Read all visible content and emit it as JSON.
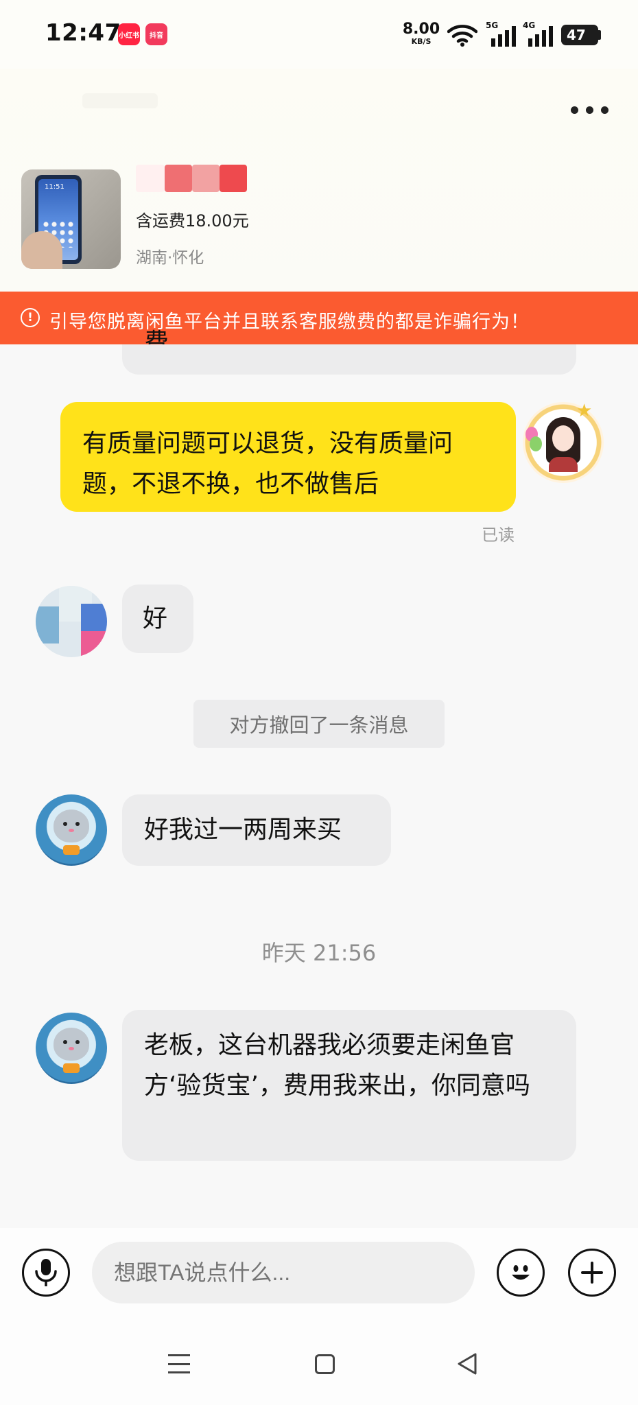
{
  "status_bar": {
    "time": "12:47",
    "app_icons": [
      "小红书",
      "抖音"
    ],
    "net_speed_value": "8.00",
    "net_speed_unit": "KB/S",
    "signal_1_label": "5G",
    "signal_2_label": "4G",
    "battery": "47"
  },
  "product": {
    "price_text": "含运费18.00元",
    "location": "湖南·怀化",
    "image_time": "11:51"
  },
  "warning": {
    "icon": "exclamation-icon",
    "text": "引导您脱离闲鱼平台并且联系客服缴费的都是诈骗行为！"
  },
  "messages": {
    "top_partial_text": "费吗",
    "reply_quality": "有质量问题可以退货，没有质量问题，不退不换，也不做售后",
    "read_status": "已读",
    "buyer_ok": "好",
    "recall_notice": "对方撤回了一条消息",
    "buyer_later": "好我过一两周来买",
    "timestamp": "昨天 21:56",
    "buyer_inspection": "老板，这台机器我必须要走闲鱼官方‘验货宝’，费用我来出，你同意吗"
  },
  "input": {
    "placeholder": "想跟TA说点什么..."
  },
  "colors": {
    "warning_bg": "#fb5b30",
    "my_bubble": "#ffe21a",
    "other_bubble": "#ececed"
  }
}
